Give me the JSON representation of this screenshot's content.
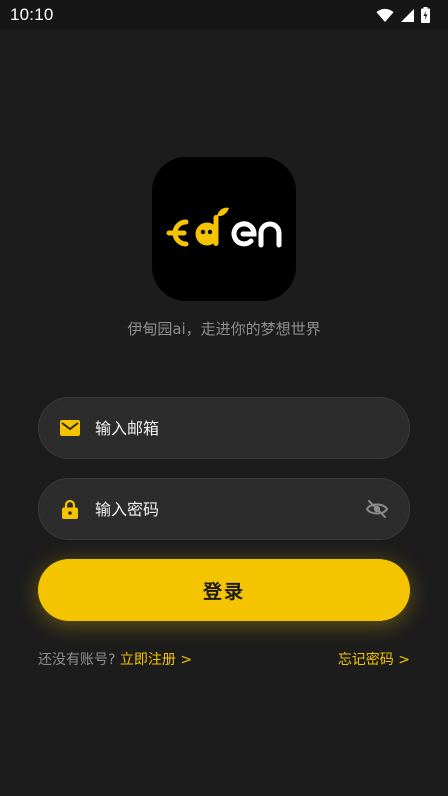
{
  "status_bar": {
    "time": "10:10",
    "icons": [
      "wifi-icon",
      "signal-icon",
      "battery-icon"
    ]
  },
  "logo": {
    "text_e": "E",
    "text_rest": "den",
    "accent_color": "#f5c400",
    "text_color": "#ffffff"
  },
  "tagline": "伊甸园ai，走进你的梦想世界",
  "email_field": {
    "placeholder": "输入邮箱",
    "value": "",
    "icon": "mail-icon"
  },
  "password_field": {
    "placeholder": "输入密码",
    "value": "",
    "icon": "lock-icon",
    "toggle_icon": "eye-off-icon"
  },
  "login_button": {
    "label": "登录"
  },
  "footer": {
    "no_account_text": "还没有账号?",
    "register_link": "立即注册 >",
    "forgot_link": "忘记密码 >"
  },
  "colors": {
    "background": "#1c1c1c",
    "accent": "#f5c400",
    "field_bg": "#2c2c2c",
    "muted_text": "#8e8e8e"
  }
}
